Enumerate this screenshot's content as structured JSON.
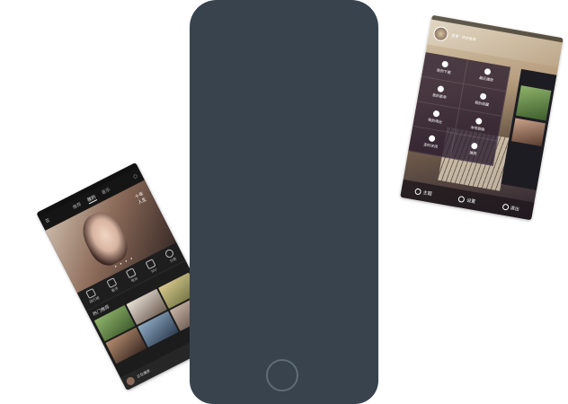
{
  "phone": {
    "color": "#38434d"
  },
  "left_screen": {
    "tabs": [
      "推荐",
      "我的",
      "音乐"
    ],
    "banner_text": "十年人生",
    "banner_dots": "• • • •",
    "quick_actions": [
      "排行榜",
      "歌手",
      "电台",
      "MV",
      "分类"
    ],
    "section_title": "热门推荐",
    "player_text": "正在播放"
  },
  "right_screen": {
    "header_text": "登录 · 同步歌单",
    "menu_items": [
      "我的下载",
      "最近播放",
      "我的歌单",
      "我的收藏",
      "我的电台",
      "本地歌曲",
      "定时关闭",
      "换肤"
    ],
    "bottom_items": [
      "主题",
      "设置",
      "退出"
    ]
  }
}
